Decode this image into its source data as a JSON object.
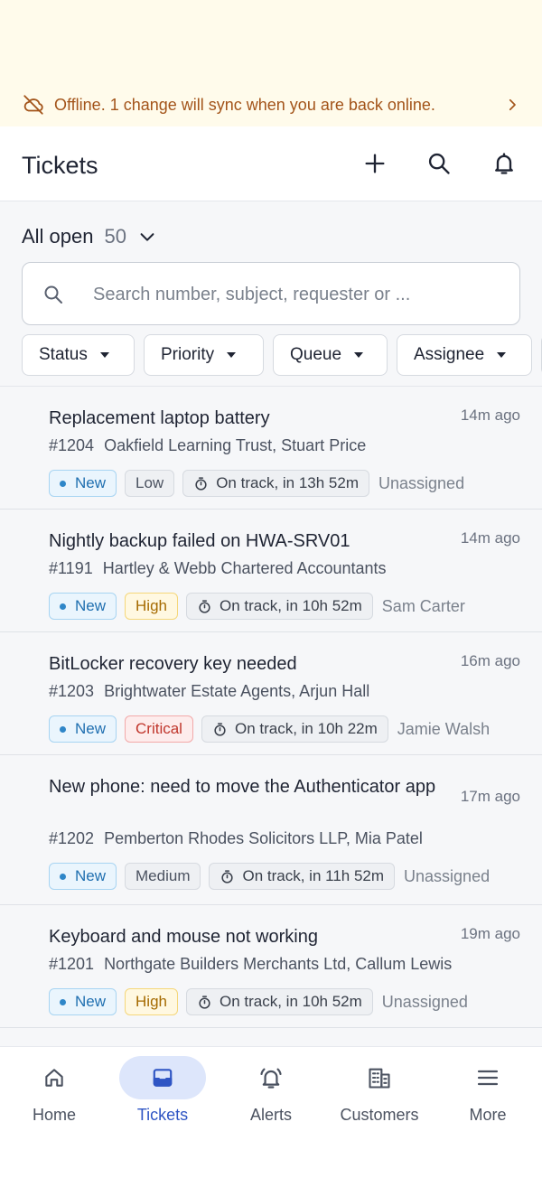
{
  "offline_banner": {
    "message": "Offline. 1 change will sync when you are back online.",
    "icon": "cloud-off-icon"
  },
  "header": {
    "title": "Tickets",
    "actions": [
      "add-icon",
      "search-icon",
      "bell-icon"
    ]
  },
  "view": {
    "name": "All open",
    "count": "50"
  },
  "search": {
    "placeholder": "Search number, subject, requester or ..."
  },
  "filters": [
    {
      "label": "Status"
    },
    {
      "label": "Priority"
    },
    {
      "label": "Queue"
    },
    {
      "label": "Assignee"
    }
  ],
  "tickets": [
    {
      "subject": "Replacement laptop battery",
      "time": "14m ago",
      "number": "#1204",
      "requester": "Oakfield Learning Trust, Stuart Price",
      "status": "New",
      "priority": "Low",
      "sla": "On track, in 13h 52m",
      "assignee": "Unassigned"
    },
    {
      "subject": "Nightly backup failed on HWA-SRV01",
      "time": "14m ago",
      "number": "#1191",
      "requester": "Hartley & Webb Chartered Accountants",
      "status": "New",
      "priority": "High",
      "sla": "On track, in 10h 52m",
      "assignee": "Sam Carter"
    },
    {
      "subject": "BitLocker recovery key needed",
      "time": "16m ago",
      "number": "#1203",
      "requester": "Brightwater Estate Agents, Arjun Hall",
      "status": "New",
      "priority": "Critical",
      "sla": "On track, in 10h 22m",
      "assignee": "Jamie Walsh"
    },
    {
      "subject": "New phone: need to move the Authenticator app",
      "time": "17m ago",
      "number": "#1202",
      "requester": "Pemberton Rhodes Solicitors LLP, Mia Patel",
      "status": "New",
      "priority": "Medium",
      "sla": "On track, in 11h 52m",
      "assignee": "Unassigned"
    },
    {
      "subject": "Keyboard and mouse not working",
      "time": "19m ago",
      "number": "#1201",
      "requester": "Northgate Builders Merchants Ltd, Callum Lewis",
      "status": "New",
      "priority": "High",
      "sla": "On track, in 10h 52m",
      "assignee": "Unassigned"
    }
  ],
  "bottom_nav": [
    {
      "label": "Home",
      "icon": "home-icon"
    },
    {
      "label": "Tickets",
      "icon": "inbox-icon",
      "active": true
    },
    {
      "label": "Alerts",
      "icon": "alarm-bell-icon"
    },
    {
      "label": "Customers",
      "icon": "building-icon"
    },
    {
      "label": "More",
      "icon": "menu-icon"
    }
  ],
  "colors": {
    "offline_text": "#a3541a",
    "offline_bg": "#fffbeb",
    "active_nav": "#2f55c4",
    "active_nav_pill": "#dde6fb"
  }
}
